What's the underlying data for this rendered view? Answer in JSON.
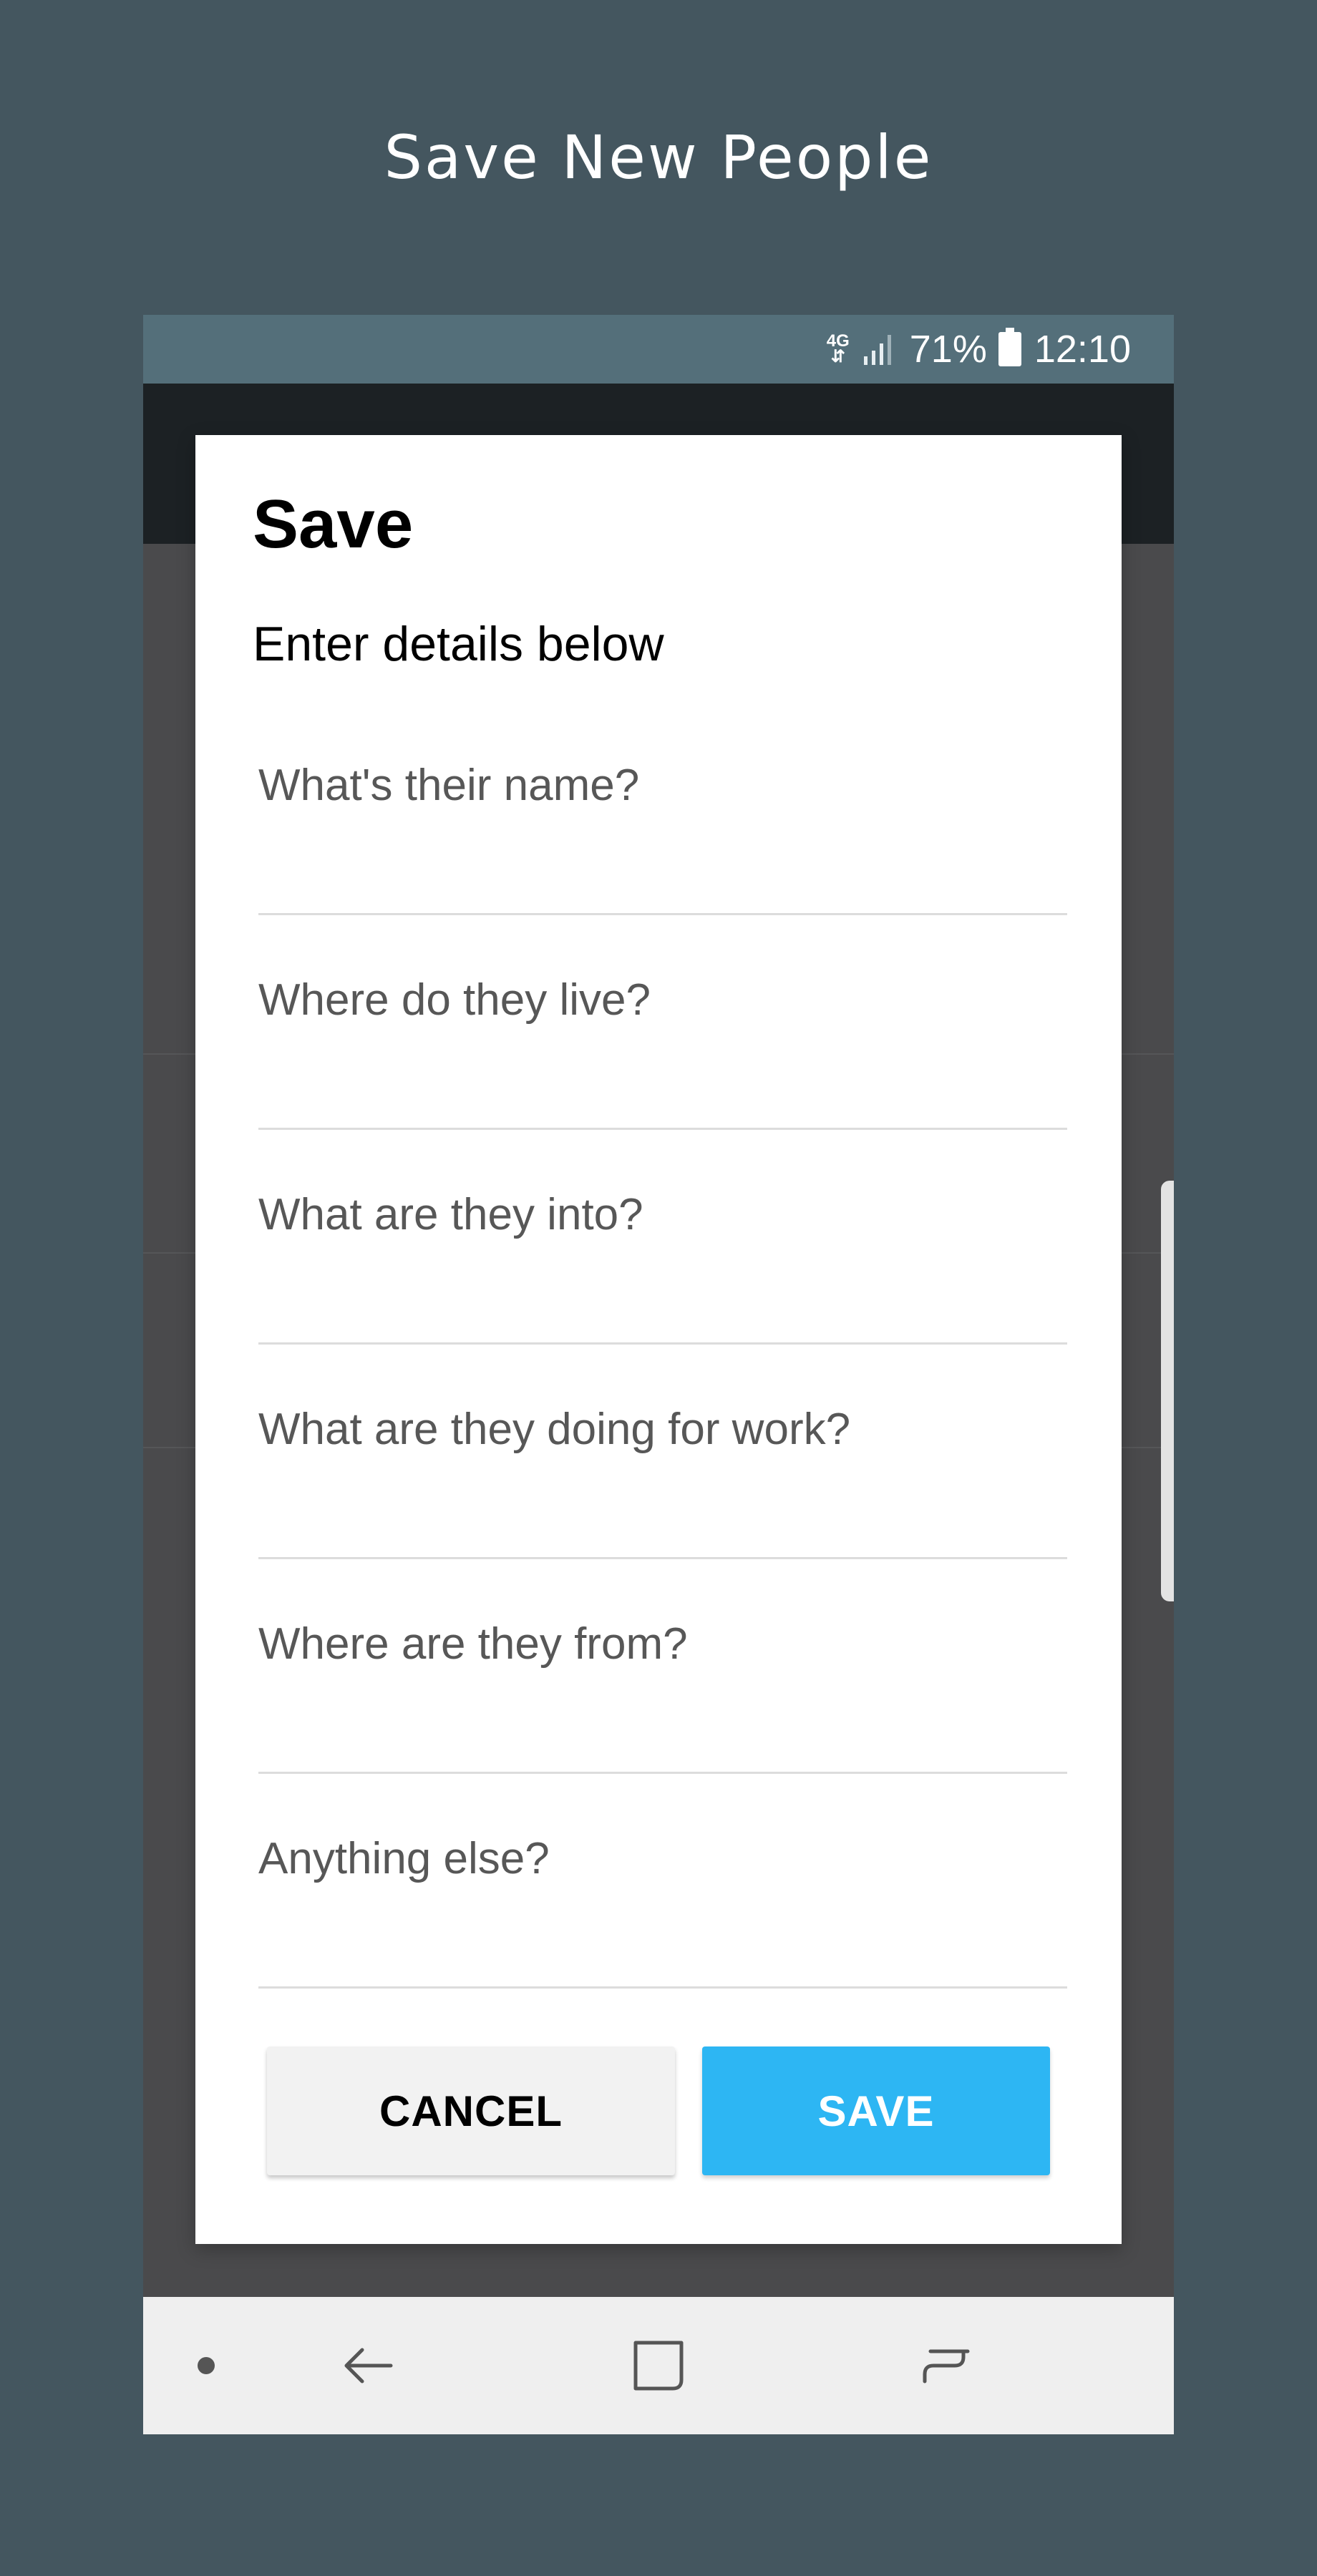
{
  "header": {
    "title": "Save New People"
  },
  "status_bar": {
    "network_top": "4G",
    "network_arrows": "⇵",
    "battery_percent": "71%",
    "time": "12:10",
    "icons": [
      "network-4g-icon",
      "signal-icon",
      "battery-icon"
    ]
  },
  "dialog": {
    "title": "Save",
    "subtitle": "Enter details below",
    "fields": [
      {
        "label": "What's their name?",
        "value": ""
      },
      {
        "label": "Where do they live?",
        "value": ""
      },
      {
        "label": "What are they into?",
        "value": ""
      },
      {
        "label": "What are they doing for work?",
        "value": ""
      },
      {
        "label": "Where are they from?",
        "value": ""
      },
      {
        "label": "Anything else?",
        "value": ""
      }
    ],
    "buttons": {
      "cancel": "CANCEL",
      "save": "SAVE"
    }
  },
  "nav_bar": {
    "icons": [
      "nav-dot-icon",
      "back-arrow-icon",
      "home-square-icon",
      "recent-apps-icon"
    ]
  },
  "colors": {
    "background": "#44565f",
    "status_bar": "#546f7a",
    "app_bar": "#1c2124",
    "accent": "#2db6f3",
    "cancel_button": "#f2f2f2"
  }
}
